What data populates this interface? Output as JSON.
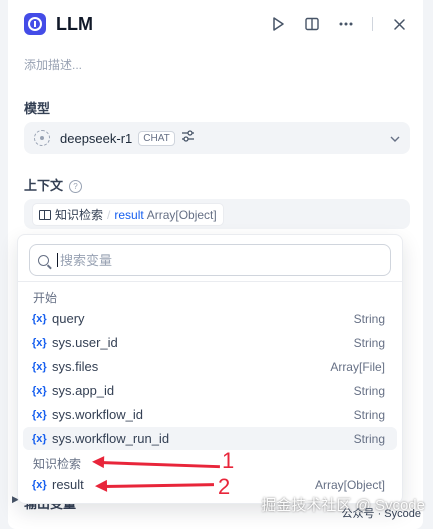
{
  "header": {
    "title": "LLM",
    "description_placeholder": "添加描述..."
  },
  "model": {
    "label": "模型",
    "name": "deepseek-r1",
    "badge": "CHAT"
  },
  "context": {
    "label": "上下文",
    "help": "?",
    "node": "知识检索",
    "separator": "/",
    "variable": "result",
    "type": "Array[Object]"
  },
  "dropdown": {
    "search_placeholder": "搜索变量",
    "groups": [
      {
        "title": "开始",
        "items": [
          {
            "icon": "{x}",
            "name": "query",
            "type": "String"
          },
          {
            "icon": "{x}",
            "name": "sys.user_id",
            "type": "String"
          },
          {
            "icon": "{x}",
            "name": "sys.files",
            "type": "Array[File]"
          },
          {
            "icon": "{x}",
            "name": "sys.app_id",
            "type": "String"
          },
          {
            "icon": "{x}",
            "name": "sys.workflow_id",
            "type": "String"
          },
          {
            "icon": "{x}",
            "name": "sys.workflow_run_id",
            "type": "String"
          }
        ]
      },
      {
        "title": "知识检索",
        "items": [
          {
            "icon": "{x}",
            "name": "result",
            "type": "Array[Object]"
          }
        ]
      }
    ]
  },
  "annotations": [
    "1",
    "2"
  ],
  "output": {
    "label": "输出变量"
  },
  "watermark": {
    "text": "掘金技术社区 @ Sycode",
    "sub": "公众号 · Sycode"
  },
  "colors": {
    "brand": "#444ce7",
    "accent": "#155eef",
    "annotation": "#e8253a"
  },
  "icons": {
    "app": "info-icon",
    "run": "play-icon",
    "panel": "panel-icon",
    "more": "more-icon",
    "close": "close-icon",
    "search": "search-icon",
    "variable": "variable-icon",
    "context_node": "book-icon"
  }
}
